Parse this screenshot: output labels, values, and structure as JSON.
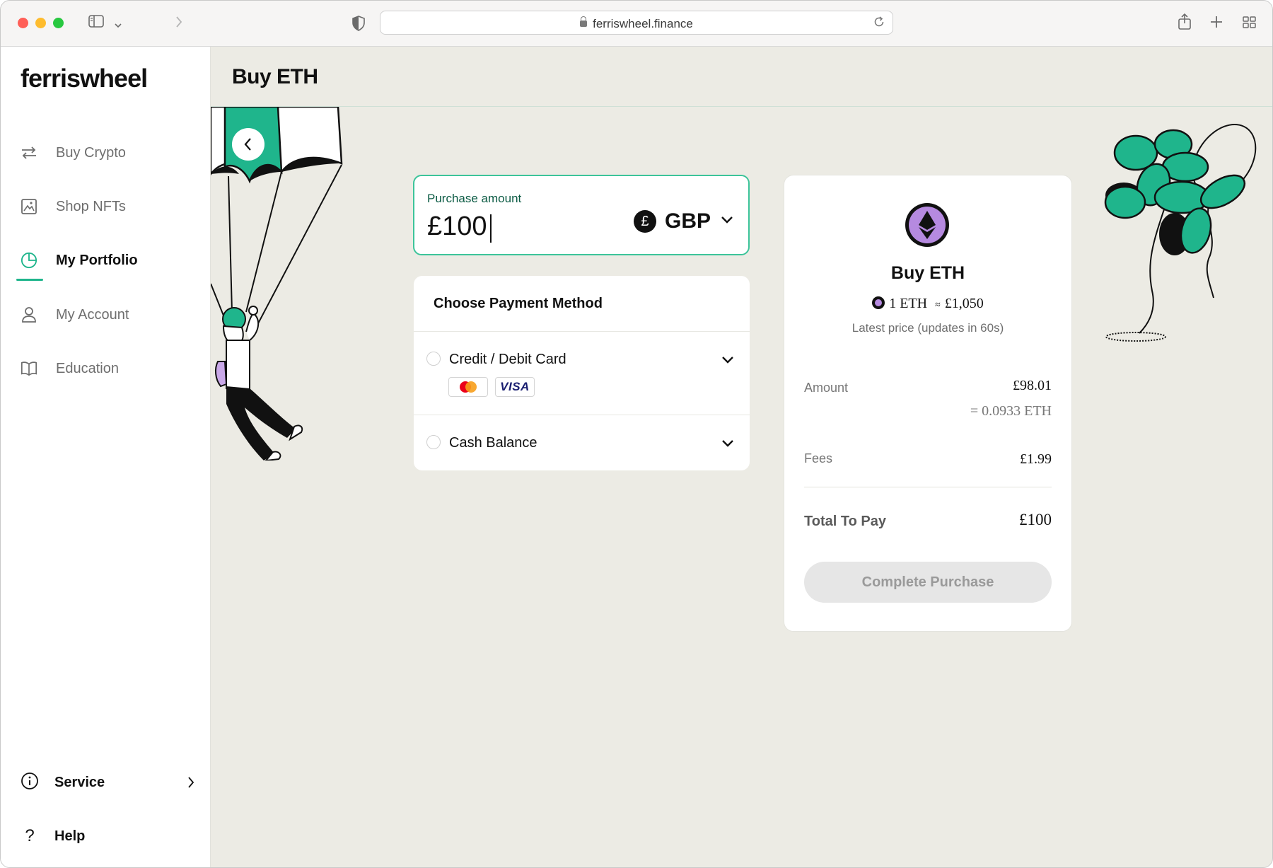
{
  "browser": {
    "url": "ferriswheel.finance",
    "icons": {
      "sidebar_toggle": "sidebar-icon",
      "forward": "chevron-right-icon",
      "shield": "shield-icon",
      "reload": "reload-icon",
      "share": "share-icon",
      "new_tab": "plus-icon",
      "tabs": "grid-icon"
    }
  },
  "brand": {
    "logo": "ferriswheel",
    "accent_color": "#1fb58c"
  },
  "sidebar": {
    "items": [
      {
        "label": "Buy Crypto",
        "icon": "swap-arrows-icon",
        "active": false
      },
      {
        "label": "Shop NFTs",
        "icon": "image-frame-icon",
        "active": false
      },
      {
        "label": "My Portfolio",
        "icon": "pie-chart-icon",
        "active": true
      },
      {
        "label": "My Account",
        "icon": "user-icon",
        "active": false
      },
      {
        "label": "Education",
        "icon": "book-icon",
        "active": false
      }
    ],
    "bottom": [
      {
        "label": "Service",
        "icon": "info-icon"
      },
      {
        "label": "Help",
        "icon": "question-icon"
      }
    ]
  },
  "page": {
    "title": "Buy ETH"
  },
  "purchase": {
    "label": "Purchase amount",
    "value": "£100",
    "currency_symbol": "£",
    "currency": "GBP"
  },
  "payment": {
    "title": "Choose Payment Method",
    "options": [
      {
        "label": "Credit / Debit Card",
        "logos": [
          "mastercard-logo",
          "visa-logo"
        ],
        "visa_text": "VISA"
      },
      {
        "label": "Cash Balance"
      }
    ]
  },
  "summary": {
    "title": "Buy ETH",
    "rate_left": "1 ETH",
    "rate_symbol": "≈",
    "rate_right": "£1,050",
    "latest_price": "Latest price (updates in 60s)",
    "amount_label": "Amount",
    "amount_value": "£98.01",
    "amount_eth": "= 0.0933 ETH",
    "fees_label": "Fees",
    "fees_value": "£1.99",
    "total_label": "Total To Pay",
    "total_value": "£100",
    "button_label": "Complete Purchase"
  }
}
